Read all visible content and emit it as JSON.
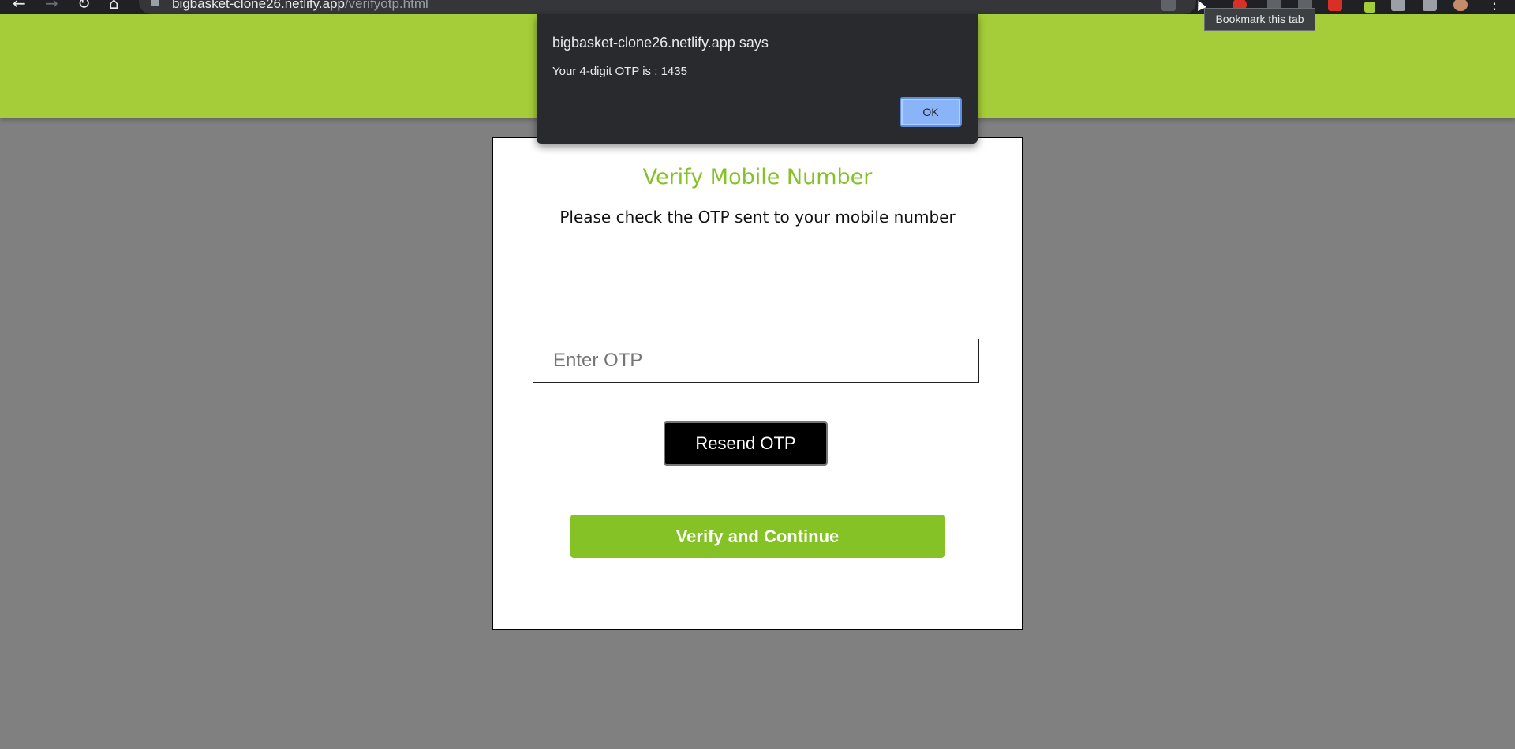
{
  "browser": {
    "url_host": "bigbasket-clone26.netlify.app",
    "url_path": "/verifyotp.html",
    "tooltip": "Bookmark this tab"
  },
  "alert": {
    "title": "bigbasket-clone26.netlify.app says",
    "message": "Your 4-digit OTP is : 1435",
    "ok_label": "OK"
  },
  "card": {
    "title": "Verify Mobile Number",
    "subtitle": "Please check the OTP sent to your mobile number",
    "otp_placeholder": "Enter OTP",
    "otp_value": "",
    "resend_label": "Resend OTP",
    "verify_label": "Verify and Continue"
  },
  "colors": {
    "header": "#a5cd39",
    "brand_green": "#84c225",
    "overlay": "#808080",
    "alert_bg": "#292a2d",
    "ok_button": "#8ab4f8"
  }
}
